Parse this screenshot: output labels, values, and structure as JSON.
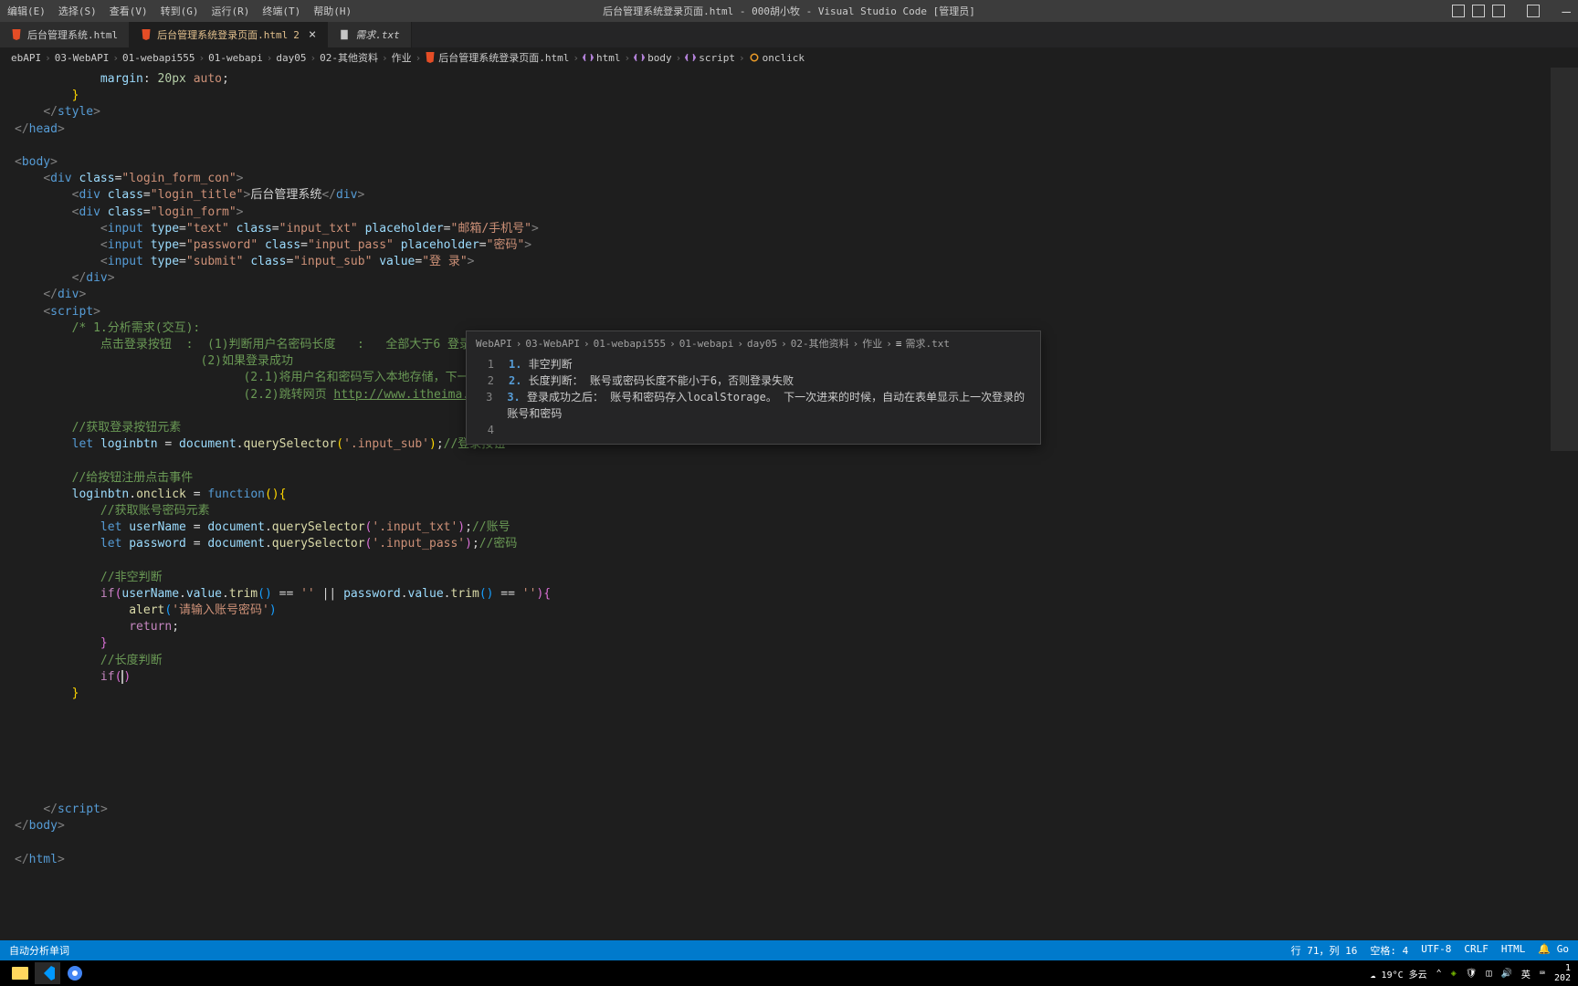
{
  "title": "后台管理系统登录页面.html - 000胡小牧 - Visual Studio Code [管理员]",
  "menu": {
    "edit": "编辑(E)",
    "select": "选择(S)",
    "view": "查看(V)",
    "go": "转到(G)",
    "run": "运行(R)",
    "terminal": "终端(T)",
    "help": "帮助(H)"
  },
  "tabs": {
    "t1": "后台管理系统.html",
    "t2": "后台管理系统登录页面.html",
    "t2mod": "2",
    "t3": "需求.txt"
  },
  "breadcrumb": {
    "p1": "ebAPI",
    "p2": "03-WebAPI",
    "p3": "01-webapi555",
    "p4": "01-webapi",
    "p5": "day05",
    "p6": "02-其他资料",
    "p7": "作业",
    "p8": "后台管理系统登录页面.html",
    "s1": "html",
    "s2": "body",
    "s3": "script",
    "s4": "onclick"
  },
  "code": {
    "l1a": "margin",
    "l1b": "20px",
    "l1c": "auto",
    "l7": "login_form_con",
    "l8a": "login_title",
    "l8b": "后台管理系统",
    "l9": "login_form",
    "l10a": "text",
    "l10b": "input_txt",
    "l10c": "邮箱/手机号",
    "l11a": "password",
    "l11b": "input_pass",
    "l11c": "密码",
    "l12a": "submit",
    "l12b": "input_sub",
    "l12c": "登 录",
    "c1": "/* 1.分析需求(交互):",
    "c2": "点击登录按钮  :  (1)判断用户名密码长度   :   全部大于6 登录成功",
    "c3": "(2)如果登录成功",
    "c4": "(2.1)将用户名和密码写入本地存储，下一次登录时直接显示用户名和密码",
    "c5a": "(2.2)跳转网页 ",
    "c5b": "http://www.itheima.com",
    "c5c": " */",
    "c6": "//获取登录按钮元素",
    "c7a": "loginbtn",
    "c7b": "'.input_sub'",
    "c7c": "//登录按钮",
    "c8": "//给按钮注册点击事件",
    "c9": "//获取账号密码元素",
    "c10a": "userName",
    "c10b": "'.input_txt'",
    "c10c": "//账号",
    "c11a": "password",
    "c11b": "'.input_pass'",
    "c11c": "//密码",
    "c12": "//非空判断",
    "c13": "'请输入账号密码'",
    "c14": "//长度判断"
  },
  "hover": {
    "bc1": "WebAPI",
    "bc2": "03-WebAPI",
    "bc3": "01-webapi555",
    "bc4": "01-webapi",
    "bc5": "day05",
    "bc6": "02-其他资料",
    "bc7": "作业",
    "bc8": "需求.txt",
    "n1": "1",
    "n2": "2",
    "n3": "3",
    "n4": "4",
    "l1a": "1.",
    "l1b": " 非空判断",
    "l2a": "2.",
    "l2b": " 长度判断：  账号或密码长度不能小于6，否则登录失败",
    "l3a": "3.",
    "l3b": " 登录成功之后：  账号和密码存入localStorage。  下一次进来的时候，自动在表单显示上一次登录的账号和密码"
  },
  "status": {
    "left": "自动分析单词",
    "pos": "行 71，列 16",
    "spaces": "空格: 4",
    "enc": "UTF-8",
    "eol": "CRLF",
    "lang": "HTML",
    "go": "Go"
  },
  "taskbar": {
    "weather": "19°C 多云",
    "ime": "英",
    "time1": "1",
    "time2": "202"
  }
}
